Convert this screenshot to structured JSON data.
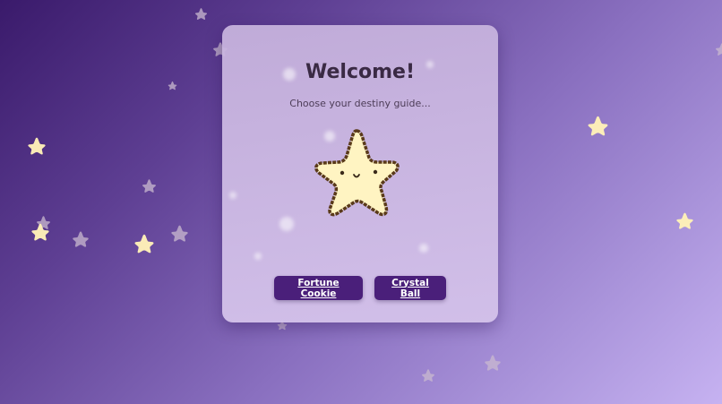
{
  "welcome": {
    "title": "Welcome!",
    "subtitle": "Choose your destiny guide..."
  },
  "mascot": {
    "icon": "smiling-star-mascot-icon",
    "fill": "#fff4c2",
    "outline": "#5a3a1a"
  },
  "buttons": {
    "fortune_cookie": "Fortune Cookie",
    "crystal_ball": "Crystal Ball"
  },
  "colors": {
    "button_bg": "#4a1f7a",
    "button_text": "#ffffff",
    "star_bright": "#fff1b8",
    "star_muted": "#c9b9cf"
  }
}
